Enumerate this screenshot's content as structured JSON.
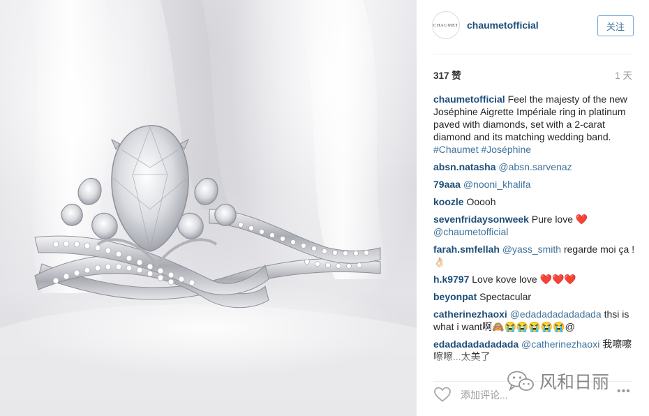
{
  "post": {
    "account": "chaumetofficial",
    "avatar_text": "CHAUMET",
    "follow_label": "关注",
    "likes": "317 赞",
    "time_ago": "1 天",
    "add_comment_placeholder": "添加评论...",
    "more_label": "•••",
    "watermark_text": "风和日丽",
    "caption": {
      "user": "chaumetofficial",
      "text": "Feel the majesty of the new Joséphine Aigrette Impériale ring in platinum paved with diamonds, set with a 2-carat diamond and its matching wedding band.",
      "tags": "#Chaumet #Joséphine"
    }
  },
  "comments": [
    {
      "user": "absn.natasha",
      "mention": "@absn.sarvenaz",
      "text": ""
    },
    {
      "user": "79aaa",
      "mention": "@nooni_khalifa",
      "text": ""
    },
    {
      "user": "koozle",
      "mention": "",
      "text": "Ooooh"
    },
    {
      "user": "sevenfridaysonweek",
      "text": "Pure love ❤️",
      "mention_after": "@chaumetofficial"
    },
    {
      "user": "farah.smfellah",
      "mention": "@yass_smith",
      "text": "regarde moi ça !👌🏻"
    },
    {
      "user": "h.k9797",
      "mention": "",
      "text": "Love kove love ❤️❤️❤️"
    },
    {
      "user": "beyonpat",
      "mention": "",
      "text": "Spectacular"
    },
    {
      "user": "catherinezhaoxi",
      "mention": "@edadadadadadada",
      "text": "thsi is what i want啊🙈😭😭😭😭😭@"
    },
    {
      "user": "edadadadadadada",
      "mention": "@catherinezhaoxi",
      "text": "我嚓嚓嚓嚓...太美了"
    }
  ],
  "colors": {
    "username_link": "#1e4e79",
    "mention_link": "#3f729b",
    "follow_border": "#70a7db",
    "muted": "#999999"
  },
  "icons": [
    "heart-icon",
    "more-options-icon",
    "wechat-watermark-icon"
  ]
}
